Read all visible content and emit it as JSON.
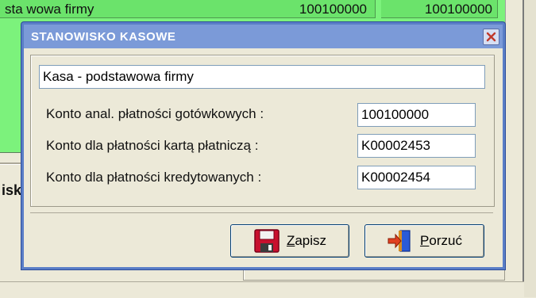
{
  "background": {
    "row_name": "sta wowa firmy",
    "row_value_1": "100100000",
    "row_value_2": "100100000",
    "left_label": "isk"
  },
  "dialog": {
    "title": "STANOWISKO KASOWE",
    "name_value": "Kasa - podstawowa firmy",
    "fields": {
      "cash_label": "Konto anal. płatności gotówkowych :",
      "cash_value": "100100000",
      "card_label": "Konto dla płatności kartą płatniczą :",
      "card_value": "K00002453",
      "credit_label": "Konto dla płatności kredytowanych :",
      "credit_value": "K00002454"
    },
    "buttons": {
      "save_mnemonic": "Z",
      "save_rest": "apisz",
      "cancel_mnemonic": "P",
      "cancel_rest": "orzuć"
    }
  },
  "colors": {
    "title_bar": "#7b9ad8",
    "grid_green": "#7cf27c",
    "save_icon": "#c8102e",
    "cancel_icon": "#2a5bd7"
  },
  "icons": {
    "save": "floppy-disk-icon",
    "cancel": "exit-door-icon",
    "close": "close-icon"
  }
}
